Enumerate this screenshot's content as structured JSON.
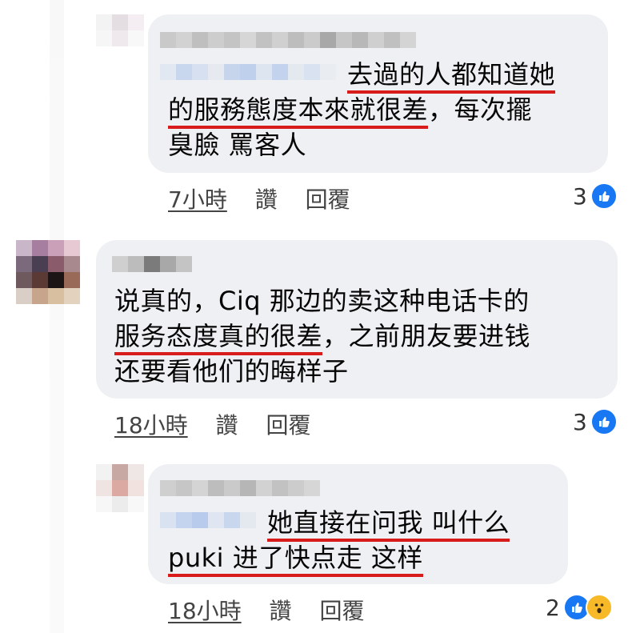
{
  "colors": {
    "bubble": "#eef0f3",
    "highlight": "#d81b1b",
    "like": "#1877f2",
    "wow": "#f7b928"
  },
  "comments": [
    {
      "line1_lead": "",
      "line1_hl": "去過的人都知道她",
      "line2_hl": "的服務態度本來就很差",
      "line2_rest": "，每次擺",
      "line3": "臭臉 罵客人",
      "time": "7小時",
      "like": "讚",
      "reply": "回覆",
      "reaction_count": "3",
      "reactions": [
        "like-icon"
      ]
    },
    {
      "line1": "说真的，Ciq 那边的卖这种电话卡的",
      "line2_hl": "服务态度真的很差",
      "line2_rest": "，之前朋友要进钱",
      "line3": "还要看他们的晦样子",
      "time": "18小時",
      "like": "讚",
      "reply": "回覆",
      "reaction_count": "3",
      "reactions": [
        "like-icon"
      ]
    },
    {
      "line1_hl": "她直接在问我 叫什么",
      "line2_hl": "puki 进了快点走 这样",
      "time": "18小時",
      "like": "讚",
      "reply": "回覆",
      "reaction_count": "2",
      "reactions": [
        "like-icon",
        "wow-icon"
      ]
    }
  ]
}
